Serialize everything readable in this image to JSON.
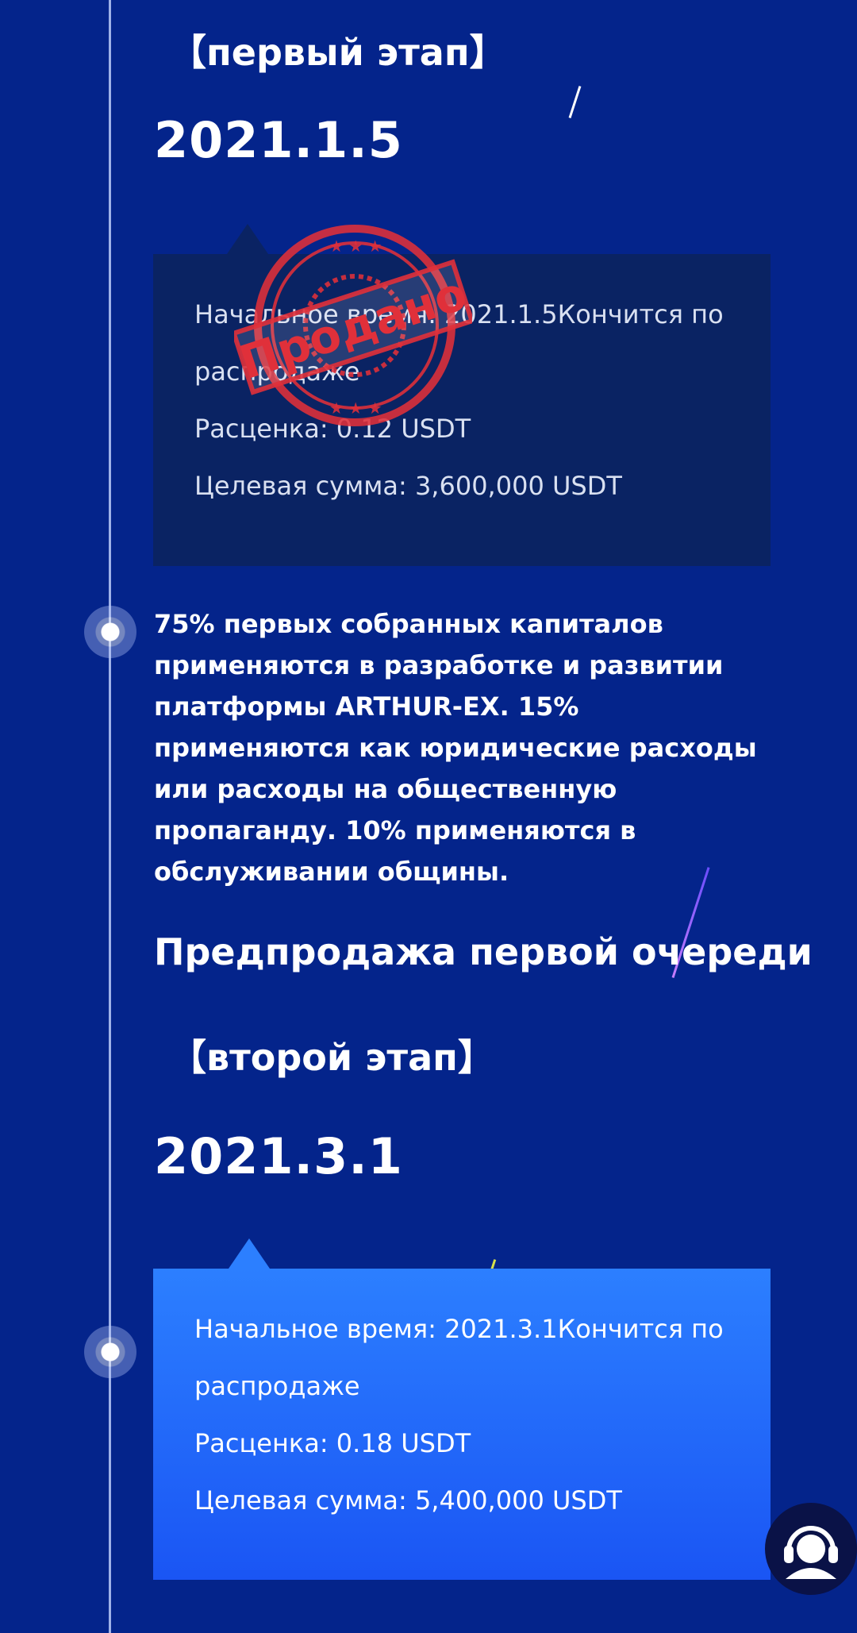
{
  "stage1": {
    "title": "【первый этап】",
    "date": "2021.1.5",
    "card": {
      "line1": "Начальное время: 2021.1.5Кончится по",
      "line2": "распродаже",
      "price": "Расценка: 0.12 USDT",
      "target": "Целевая сумма: 3,600,000 USDT"
    },
    "stamp_text": "Продано"
  },
  "description": "75% первых собранных капиталов применяются в разработке и развитии платформы ARTHUR-EX. 15% применяются как юридические расходы или расходы на общественную пропаганду. 10% применяются в обслуживании общины.",
  "presale_heading": "Предпродажа первой очереди",
  "stage2": {
    "title": "【второй этап】",
    "date": "2021.3.1",
    "card": {
      "line1": "Начальное время: 2021.3.1Кончится по",
      "line2": "распродаже",
      "price": "Расценка: 0.18 USDT",
      "target": "Целевая сумма: 5,400,000 USDT"
    }
  },
  "colors": {
    "background": "#04248b",
    "card_dark": "#0a2363",
    "card_blue": "#2c7fff",
    "stamp": "#e0303a"
  },
  "icons": {
    "support": "customer-support-headset-icon",
    "timeline_dot": "timeline-dot-icon"
  }
}
